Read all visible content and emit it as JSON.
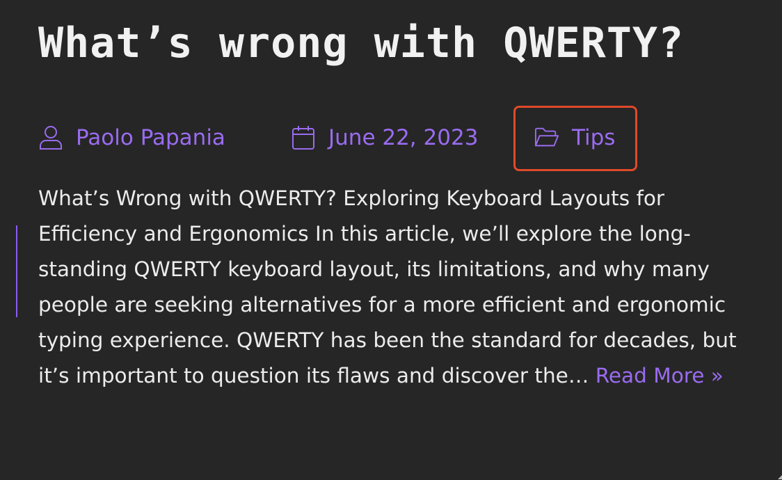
{
  "post": {
    "title": "What’s wrong with QWERTY?",
    "meta": {
      "author": "Paolo Papania",
      "author_icon": "user-icon",
      "date": "June 22, 2023",
      "date_icon": "calendar-icon",
      "category": "Tips",
      "category_icon": "folder-icon"
    },
    "excerpt": "What’s Wrong with QWERTY? Exploring Keyboard Layouts for Efficiency and Ergonomics In this article, we’ll explore the long-standing QWERTY keyboard layout, its limitations, and why many people are seeking alternatives for a more efficient and ergonomic typing experience. QWERTY has been the standard for decades, but it’s important to question its flaws and discover the…",
    "read_more": "Read More »"
  },
  "colors": {
    "background": "#262626",
    "text": "#ececec",
    "accent": "#9a6cf0",
    "highlight_border": "#e04a2a"
  }
}
